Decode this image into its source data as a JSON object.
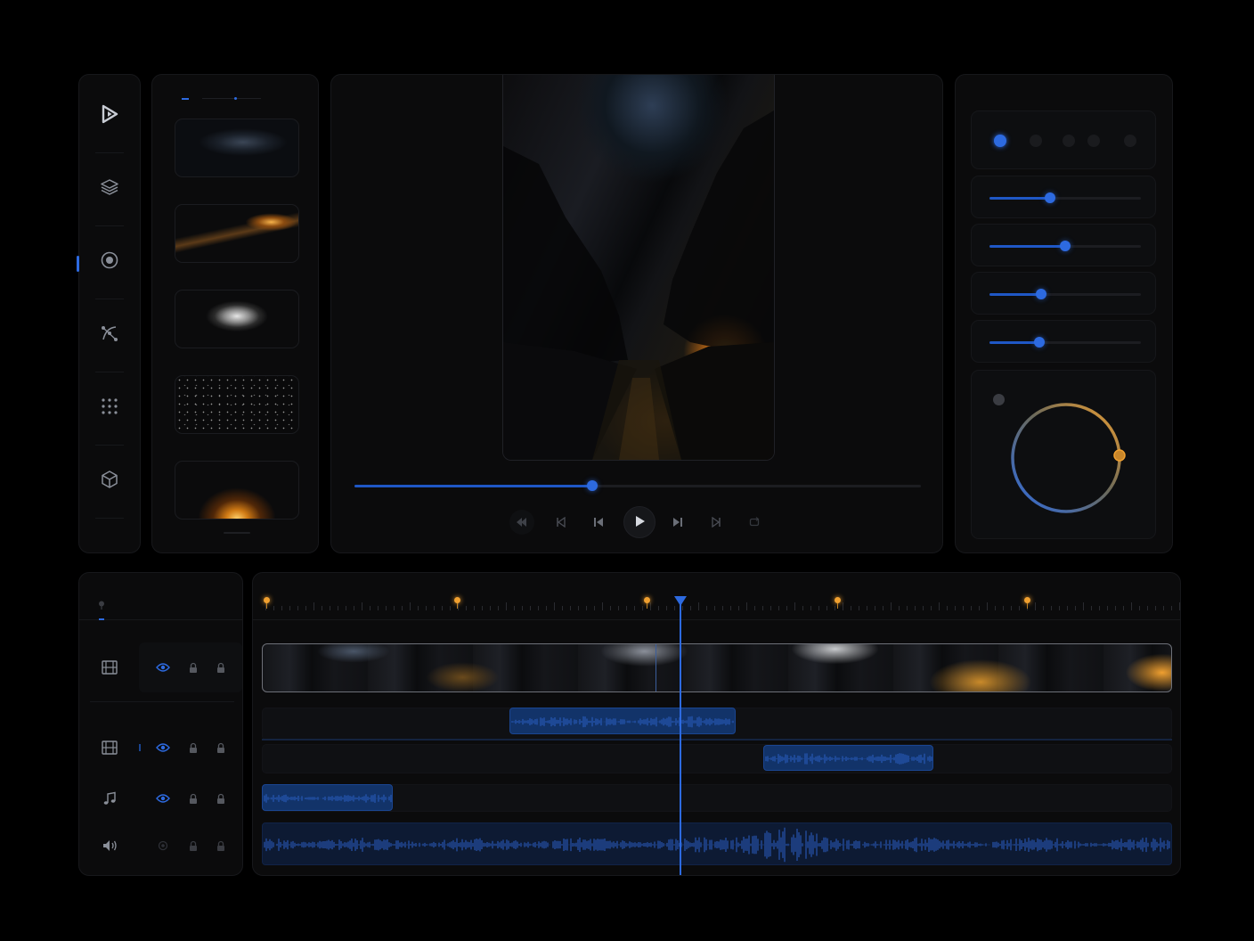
{
  "colors": {
    "accent": "#2d6ae0",
    "accent_dark": "#123369",
    "highlight_orange": "#f0a030",
    "background": "#000000",
    "panel": "#0b0b0c"
  },
  "sidebar": {
    "active_index": 2,
    "items": [
      {
        "name": "logo",
        "icon": "play-logo-icon"
      },
      {
        "name": "layers",
        "icon": "layers-icon"
      },
      {
        "name": "effects",
        "icon": "record-circle-icon"
      },
      {
        "name": "curves",
        "icon": "bezier-path-icon"
      },
      {
        "name": "grid",
        "icon": "dots-grid-icon"
      },
      {
        "name": "3d",
        "icon": "cube-icon"
      }
    ]
  },
  "assets": {
    "items": [
      {
        "name": "smoke-cloud",
        "icon": "smoke-thumbnail"
      },
      {
        "name": "lava-crack",
        "icon": "lava-thumbnail"
      },
      {
        "name": "white-mist",
        "icon": "mist-thumbnail"
      },
      {
        "name": "starfield",
        "icon": "stars-thumbnail"
      },
      {
        "name": "sun-glow",
        "icon": "glow-thumbnail"
      }
    ]
  },
  "preview": {
    "progress": 0.42,
    "controls": [
      {
        "name": "rewind",
        "icon": "rewind-icon"
      },
      {
        "name": "prev-frame",
        "icon": "step-back-icon"
      },
      {
        "name": "skip-start",
        "icon": "skip-back-icon"
      },
      {
        "name": "play",
        "icon": "play-icon"
      },
      {
        "name": "skip-end",
        "icon": "skip-forward-icon"
      },
      {
        "name": "next-frame",
        "icon": "step-forward-icon"
      },
      {
        "name": "loop",
        "icon": "loop-icon"
      }
    ]
  },
  "properties": {
    "swatches": [
      "#2d6ae0",
      "#1a1b1e",
      "#1a1b1e",
      "#1a1b1e",
      "#1a1b1e"
    ],
    "sliders": [
      0.4,
      0.5,
      0.34,
      0.33
    ],
    "dial_value": 0.52
  },
  "timeline": {
    "playhead": 0.46,
    "markers": [
      0.0,
      0.21,
      0.42,
      0.63,
      0.84
    ],
    "tracks": [
      {
        "type": "video",
        "icon": "film-icon",
        "visible": true,
        "locked": false
      },
      {
        "type": "video",
        "icon": "film-icon",
        "visible": true,
        "locked": false
      },
      {
        "type": "music",
        "icon": "music-note-icon",
        "visible": true,
        "locked": false
      },
      {
        "type": "sound",
        "icon": "speaker-icon",
        "visible": false,
        "locked": false
      }
    ]
  }
}
